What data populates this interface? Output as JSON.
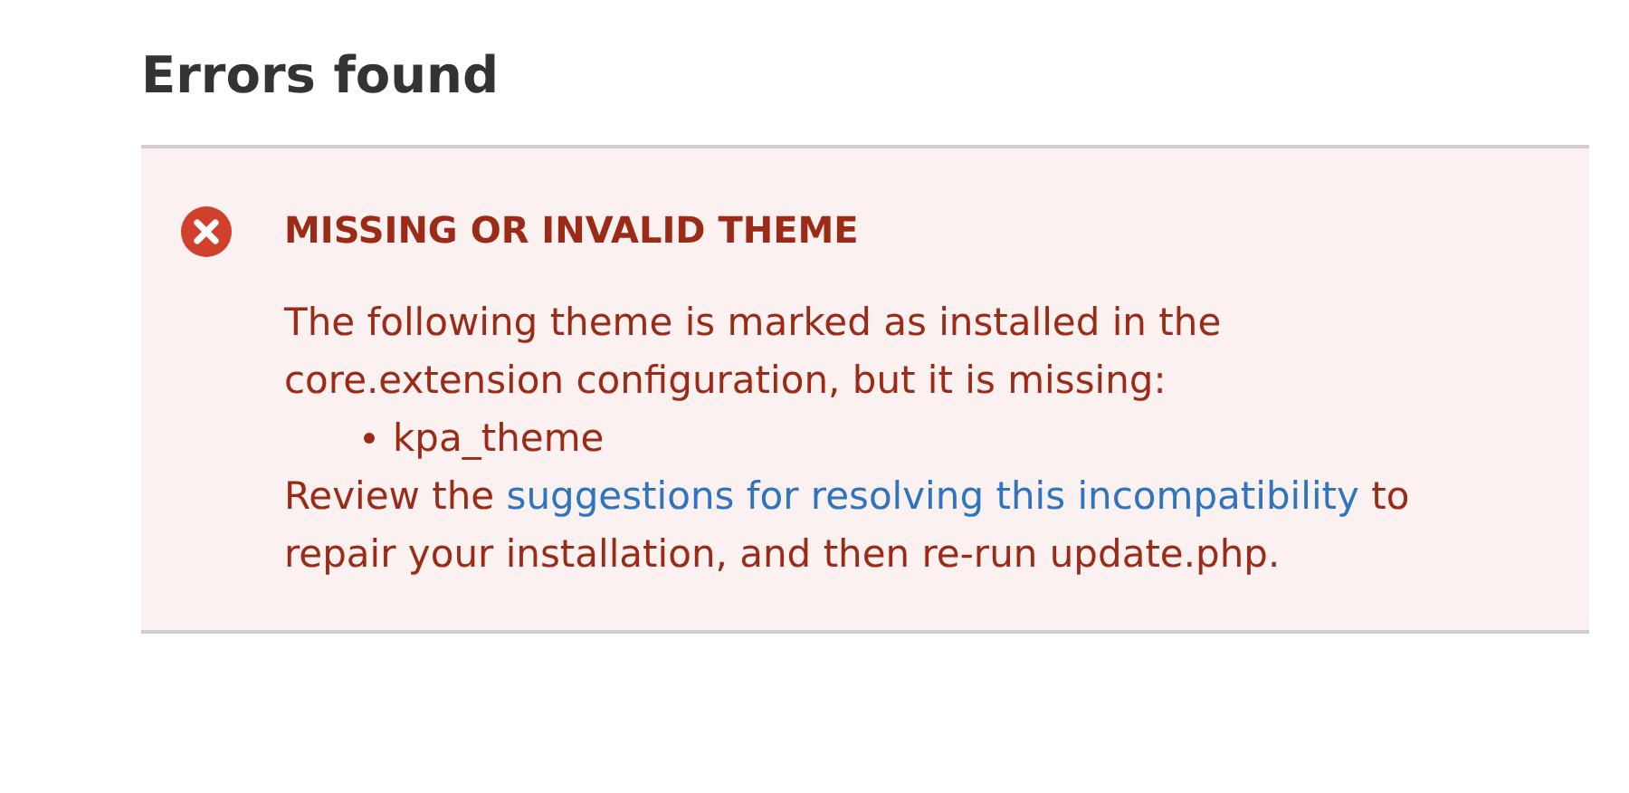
{
  "heading": "Errors found",
  "error": {
    "title": "MISSING OR INVALID THEME",
    "description": "The following theme is marked as installed in the core.extension configuration, but it is missing:",
    "items": [
      "kpa_theme"
    ],
    "review_before": "Review the ",
    "review_link": "suggestions for resolving this incompatibility",
    "review_after": " to repair your installation, and then re-run update.php."
  }
}
